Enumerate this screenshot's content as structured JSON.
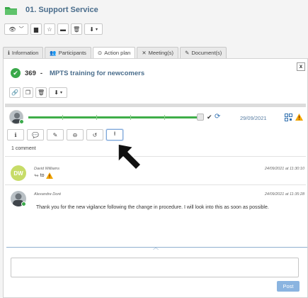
{
  "folder": {
    "title": "01. Support Service",
    "icon": "folder-icon"
  },
  "toolbar": {
    "icons": [
      "eye-icon",
      "chevron-down-icon",
      "folder-add-icon",
      "star-icon",
      "archive-icon",
      "trash-icon",
      "download-icon",
      "chevron-down-icon"
    ]
  },
  "tabs": [
    {
      "label": "Information",
      "icon": "info-icon"
    },
    {
      "label": "Participants",
      "icon": "users-icon"
    },
    {
      "label": "Action plan",
      "icon": "clock-check-icon",
      "active": true
    },
    {
      "label": "Meeting(s)",
      "icon": "meeting-icon"
    },
    {
      "label": "Document(s)",
      "icon": "paperclip-icon"
    }
  ],
  "action": {
    "number": "369",
    "separator": "-",
    "title": "MPTS training for newcomers",
    "status_icon": "check-circle-icon",
    "close": "x"
  },
  "action_toolbar": {
    "icons": [
      "link-icon",
      "copy-icon",
      "trash-icon",
      "download-icon",
      "chevron-down-icon"
    ]
  },
  "progress": {
    "percent": 94,
    "date": "29/09/2021"
  },
  "subtabs": {
    "icons": [
      "info-icon",
      "comment-icon",
      "paperclip-icon",
      "minus-circle-icon",
      "history-icon",
      "upload-icon"
    ],
    "active_index": 5
  },
  "comments": {
    "count_label": "1 comment",
    "items": [
      {
        "author": "David Williams",
        "initials": "DW",
        "date": "24/09/2021 at 11:30:10",
        "action_to": "to",
        "text": ""
      },
      {
        "author": "Alexandre Doré",
        "initials": "",
        "date": "24/09/2021 at 11:35:28",
        "text": "Thank you for the new vigilance following the change in procedure. I will look into this as soon as possible."
      }
    ]
  },
  "composer": {
    "placeholder": "",
    "post_label": "Post"
  },
  "colors": {
    "accent": "#4a6d8c",
    "success": "#3aa94a",
    "warning": "#f0a500",
    "post": "#8ab4e0"
  }
}
